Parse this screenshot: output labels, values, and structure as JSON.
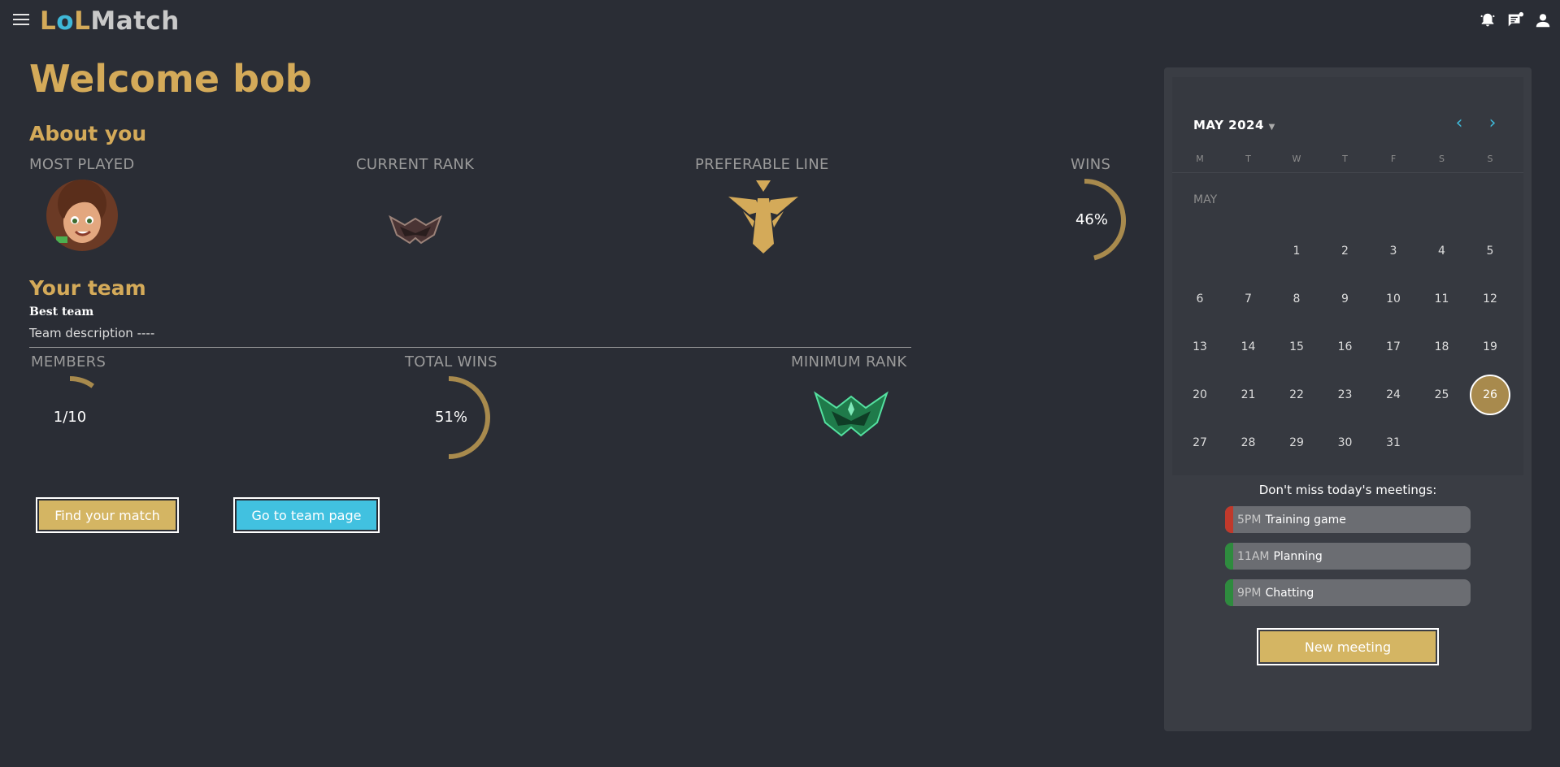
{
  "header": {
    "logo": {
      "letters": [
        "L",
        "o",
        "L",
        "Match"
      ],
      "colors": [
        "#d4aa59",
        "#3fb8d8",
        "#d4aa59",
        "#c9c9c9"
      ]
    },
    "icons": [
      "menu-icon",
      "notification-icon",
      "message-icon",
      "user-icon"
    ]
  },
  "welcome": "Welcome bob",
  "about": {
    "title": "About you",
    "most_played_label": "MOST PLAYED",
    "current_rank_label": "CURRENT RANK",
    "preferable_line_label": "PREFERABLE LINE",
    "wins_label": "WINS",
    "wins_value": "46%",
    "wins_fraction": 0.46
  },
  "team": {
    "title": "Your team",
    "name": "Best team",
    "description": "Team description ----",
    "members_label": "MEMBERS",
    "members_value": "1/10",
    "members_fraction": 0.1,
    "total_wins_label": "TOTAL WINS",
    "total_wins_value": "51%",
    "total_wins_fraction": 0.51,
    "minimum_rank_label": "MINIMUM RANK"
  },
  "buttons": {
    "find_match": "Find your match",
    "team_page": "Go to team page",
    "new_meeting": "New meeting"
  },
  "calendar": {
    "month_title": "MAY 2024",
    "month_label": "MAY",
    "weekdays": [
      "M",
      "T",
      "W",
      "T",
      "F",
      "S",
      "S"
    ],
    "days": [
      "1",
      "2",
      "3",
      "4",
      "5",
      "6",
      "7",
      "8",
      "9",
      "10",
      "11",
      "12",
      "13",
      "14",
      "15",
      "16",
      "17",
      "18",
      "19",
      "20",
      "21",
      "22",
      "23",
      "24",
      "25",
      "26",
      "27",
      "28",
      "29",
      "30",
      "31"
    ],
    "first_weekday_index": 2,
    "today": "26"
  },
  "meetings": {
    "title": "Don't miss today's meetings:",
    "items": [
      {
        "time": "5PM",
        "title": "Training game",
        "color": "#c0392b"
      },
      {
        "time": "11AM",
        "title": "Planning",
        "color": "#2e8b3e"
      },
      {
        "time": "9PM",
        "title": "Chatting",
        "color": "#2e8b3e"
      }
    ]
  },
  "colors": {
    "gold": "#d4aa59",
    "gauge": "#a88a4d",
    "cyan": "#3fc1e0",
    "background": "#2a2d35"
  }
}
